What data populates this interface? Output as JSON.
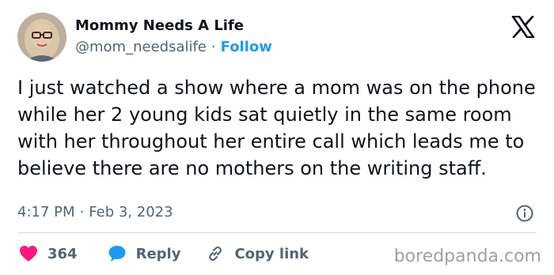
{
  "author": {
    "display_name": "Mommy Needs A Life",
    "handle": "@mom_needsalife",
    "separator": "·",
    "follow_label": "Follow"
  },
  "tweet": {
    "text": "I just watched a show where a mom was on the phone while her 2 young kids sat quietly in the same room with her throughout her entire call which leads me to believe there are no mothers on the writing staff.",
    "time": "4:17 PM",
    "date": "Feb 3, 2023",
    "separator": "·"
  },
  "actions": {
    "likes_count": "364",
    "reply_label": "Reply",
    "copy_link_label": "Copy link"
  },
  "icons": {
    "platform_logo": "x-logo-icon",
    "info": "info-icon",
    "like": "heart-icon",
    "reply": "speech-bubble-icon",
    "copy_link": "link-icon"
  },
  "colors": {
    "accent": "#1d9bf0",
    "like": "#f91880",
    "text": "#0f1419",
    "secondary_text": "#536471",
    "watermark": "#9aa2a9"
  },
  "watermark": "boredpanda.com"
}
